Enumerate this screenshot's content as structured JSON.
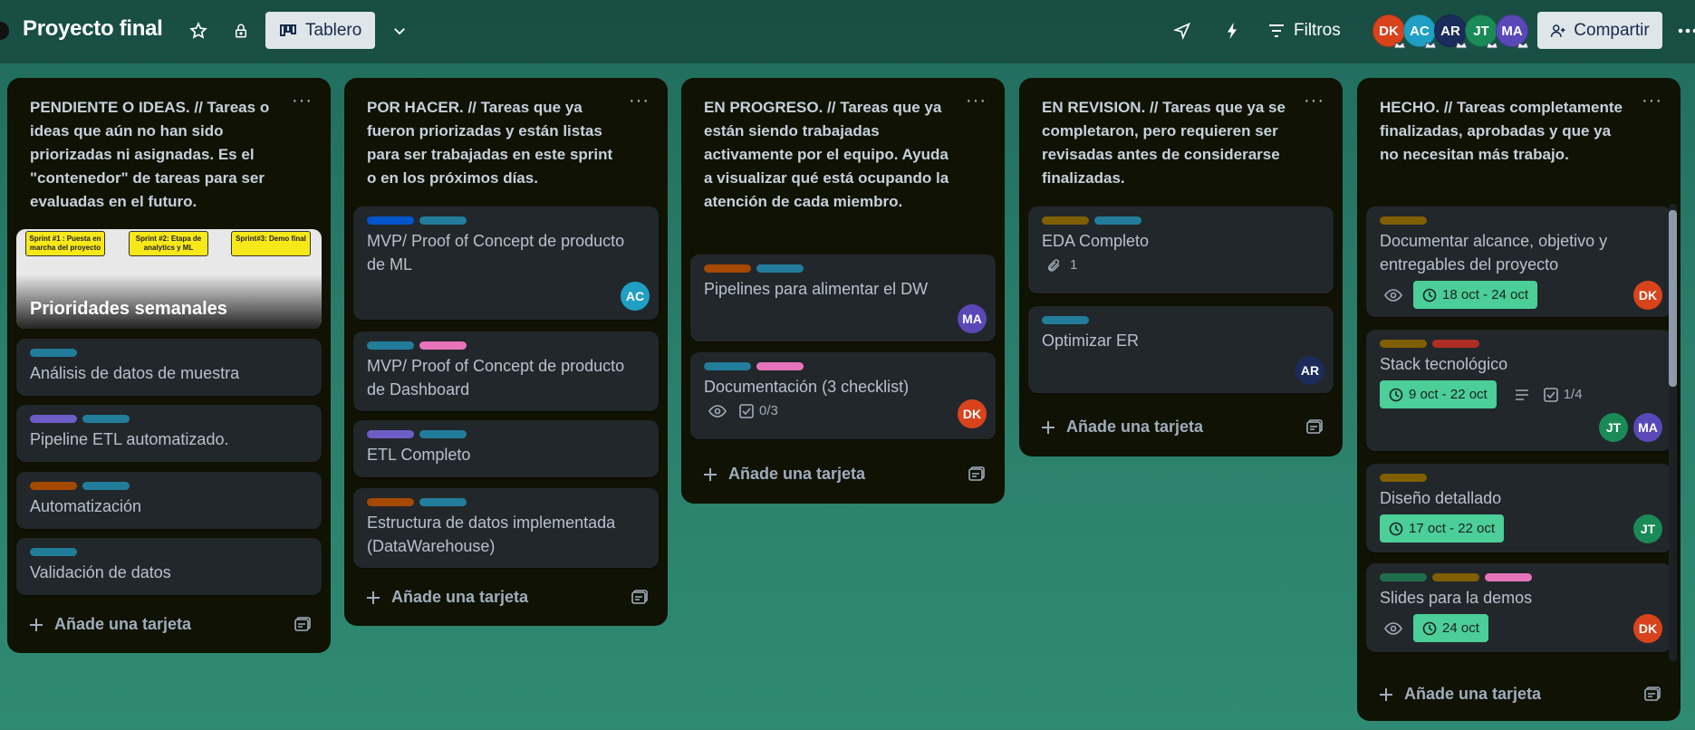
{
  "header": {
    "board_title": "Proyecto final",
    "view_label": "Tablero",
    "filter_label": "Filtros",
    "share_label": "Compartir",
    "members": [
      {
        "initials": "DK",
        "color": "#d9431b"
      },
      {
        "initials": "AC",
        "color": "#1f9fc4"
      },
      {
        "initials": "AR",
        "color": "#1b2c5a"
      },
      {
        "initials": "JT",
        "color": "#1a8a56"
      },
      {
        "initials": "MA",
        "color": "#5a48b8"
      }
    ]
  },
  "lists": [
    {
      "title": "PENDIENTE O IDEAS. // Tareas o ideas que aún no han sido priorizadas ni asignadas. Es el \"contenedor\" de tareas para ser evaluadas en el futuro.",
      "cover": {
        "title": "Prioridades semanales",
        "sprints": [
          "Sprint #1 : Puesta en marcha del proyecto",
          "Sprint #2: Etapa de analytics y ML",
          "Sprint#3: Demo final"
        ]
      },
      "cards": [
        {
          "title": "Análisis de datos de muestra"
        },
        {
          "title": "Pipeline ETL automatizado."
        },
        {
          "title": "Automatización"
        },
        {
          "title": "Validación de datos"
        }
      ],
      "add_label": "Añade una tarjeta"
    },
    {
      "title": "POR HACER. // Tareas que ya fueron priorizadas y están listas para ser trabajadas en este sprint o en los próximos días.",
      "cards": [
        {
          "title": "MVP/ Proof of Concept de producto de ML",
          "member": "AC"
        },
        {
          "title": "MVP/ Proof of Concept de producto de Dashboard"
        },
        {
          "title": "ETL Completo"
        },
        {
          "title": "Estructura de datos implementada (DataWarehouse)"
        }
      ],
      "add_label": "Añade una tarjeta"
    },
    {
      "title": "EN PROGRESO. // Tareas que ya están siendo trabajadas activamente por el equipo. Ayuda a visualizar qué está ocupando la atención de cada miembro.",
      "cards": [
        {
          "title": "Pipelines para alimentar el DW",
          "member": "MA"
        },
        {
          "title": "Documentación (3 checklist)",
          "checklist": "0/3",
          "member": "DK"
        }
      ],
      "add_label": "Añade una tarjeta"
    },
    {
      "title": "EN REVISION. // Tareas que ya se completaron, pero requieren ser revisadas antes de considerarse finalizadas.",
      "cards": [
        {
          "title": "EDA Completo",
          "attachments": "1"
        },
        {
          "title": "Optimizar ER",
          "member": "AR"
        }
      ],
      "add_label": "Añade una tarjeta"
    },
    {
      "title": "HECHO. // Tareas completamente finalizadas, aprobadas y que ya no necesitan más trabajo.",
      "cards": [
        {
          "title": "Documentar alcance, objetivo y entregables del proyecto",
          "date": "18 oct - 24 oct",
          "member": "DK"
        },
        {
          "title": "Stack tecnológico",
          "date": "9 oct - 22 oct",
          "checklist": "1/4",
          "members": [
            "JT",
            "MA"
          ]
        },
        {
          "title": "Diseño detallado",
          "date": "17 oct - 22 oct",
          "member": "JT"
        },
        {
          "title": "Slides para la demos",
          "date": "24 oct",
          "member": "DK"
        }
      ],
      "add_label": "Añade una tarjeta"
    }
  ],
  "label_colors": {
    "teal": "#227d9b",
    "purple": "#6e5dc6",
    "orange": "#a54800",
    "blue": "#0055cc",
    "pink": "#e774bb",
    "yellow": "#7f5f01",
    "red": "#ae2e24",
    "green": "#216e4e"
  }
}
